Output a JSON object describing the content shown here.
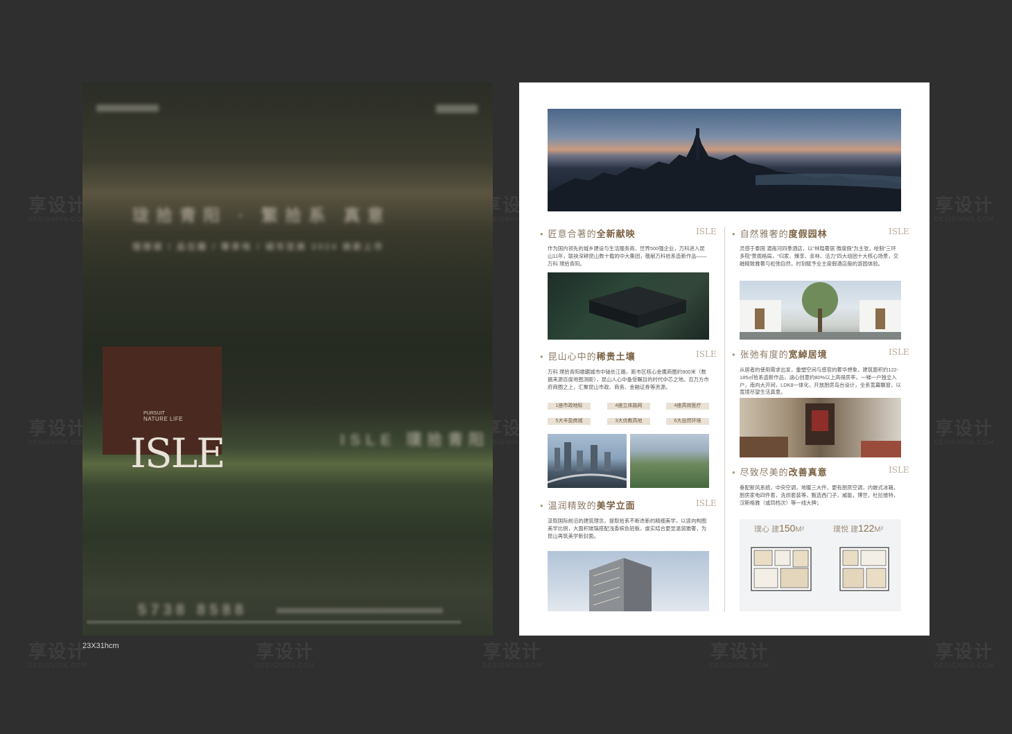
{
  "watermark": {
    "brand": "享设计",
    "url": "DESIGN006.COM"
  },
  "size_label": "23X31hcm",
  "poster": {
    "logo": "ISLE",
    "logo_sub": "NATURE LIFE",
    "logo_pursuit": "PURSUIT",
    "blurred_headline": "珑拾青阳 ∙ 繁拾系 真意",
    "blurred_subline": "理想城 / 品位圈 / 尊享地 / 城市至美 2024 焕新上市",
    "blurred_brand_line": "ISLE 璞拾青阳",
    "blurred_phone": "5738 8588"
  },
  "brochure": {
    "sections": [
      {
        "lead": "匠意合著的",
        "strong": "全新献映",
        "badge": "ISLE",
        "body": "作为国内领先的城乡建设与生活服务商，世界500强企业，万科进入昆山11年，联袂深耕昆山数十载的中大集团，敬献万科拾系造新作品——万科 璞拾青阳。"
      },
      {
        "lead": "昆山心中的",
        "strong": "稀贵土壤",
        "badge": "ISLE",
        "body": "万科 璞拾青阳雄踞城市中轴长江路，距市区核心金鹰商圈约900米（数据来源百度地图测距），昆山人心中备受瞩目的时代中芯之地。百万方市府商圈之上，汇聚昆山市政、商务、金融证券等资源。",
        "tags": [
          "1座市政地标",
          "4座立体路网",
          "4座高效医疗",
          "5大丰盈商城",
          "3大优教高地",
          "6大自然环境"
        ]
      },
      {
        "lead": "温润精致的",
        "strong": "美学立面",
        "badge": "ISLE",
        "body": "汲取国际前沿的建筑理念，提取拾系不断迭新的精细美学，以竖向构图美学比例，大面积玻璃搭配浅香槟色铝板，虔实结合更显温润雅奢，为昆山再筑美学新封面。"
      },
      {
        "lead": "自然雅奢的",
        "strong": "度假园林",
        "badge": "ISLE",
        "body": "灵感于泰国 湄南河四季酒店，以“林隐奢居 微度假”为主张，绘制“三环多院”景观格局，“归家、臻享、亲林、活力”四大组团十大核心场景，交融精致雅奢与松弛自然，时刻赋予业主度假酒店般的游园体验。"
      },
      {
        "lead": "张弛有度的",
        "strong": "宽綽居境",
        "badge": "ISLE",
        "body": "从居者的使用需求出发，重塑空间与感官的奢华想象，建筑面积约122-185㎡拾系造新作品，涵心创意约80%以上高得房率，一梯一户独立入户，南向大开间，LDK8一体化，开放厨房岛台设计，全系宽幕飘窗，以宽境尽望生活真意。"
      },
      {
        "lead": "尽致尽美的",
        "strong": "改善真意",
        "badge": "ISLE",
        "body": "垂配新风系统，中央空调，地暖三大件，更有厨房空调，内嵌式冰箱，厨房家电四件套，洗烘套装等，甄选西门子，威能，博世，杜拉维特，汉斯格雅（或同档次）等一线大牌；"
      }
    ],
    "floorplans": [
      {
        "name": "璞心",
        "size_prefix": "建",
        "size": "150",
        "unit": "M²"
      },
      {
        "name": "璞悦",
        "size_prefix": "建",
        "size": "122",
        "unit": "M²"
      }
    ]
  }
}
